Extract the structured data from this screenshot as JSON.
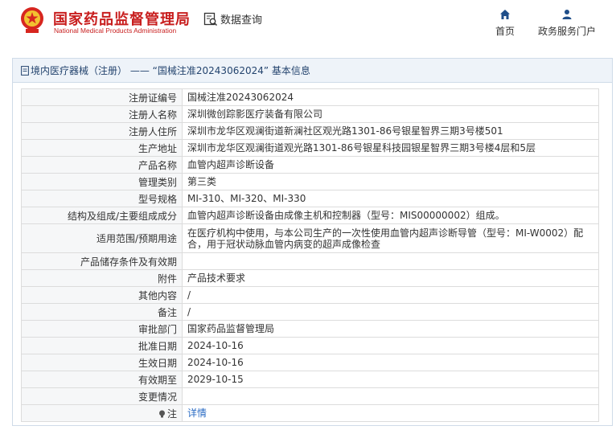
{
  "header": {
    "brand_cn": "国家药品监督管理局",
    "brand_en": "National Medical Products Administration",
    "query_label": "数据查询",
    "nav": [
      {
        "icon": "home-icon",
        "label": "首页"
      },
      {
        "icon": "user-icon",
        "label": "政务服务门户"
      }
    ]
  },
  "panel": {
    "title_type": "境内医疗器械（注册）",
    "title_sep": "——",
    "title_number": "“国械注准20243062024”",
    "title_suffix": "基本信息"
  },
  "rows": [
    {
      "label": "注册证编号",
      "value": "国械注准20243062024"
    },
    {
      "label": "注册人名称",
      "value": "深圳微创踪影医疗装备有限公司"
    },
    {
      "label": "注册人住所",
      "value": "深圳市龙华区观澜街道新澜社区观光路1301-86号银星智界三期3号楼501"
    },
    {
      "label": "生产地址",
      "value": "深圳市龙华区观澜街道观光路1301-86号银星科技园银星智界三期3号楼4层和5层"
    },
    {
      "label": "产品名称",
      "value": "血管内超声诊断设备"
    },
    {
      "label": "管理类别",
      "value": "第三类"
    },
    {
      "label": "型号规格",
      "value": "MI-310、MI-320、MI-330"
    },
    {
      "label": "结构及组成/主要组成成分",
      "value": "血管内超声诊断设备由成像主机和控制器（型号：MIS00000002）组成。"
    },
    {
      "label": "适用范围/预期用途",
      "value": "在医疗机构中使用，与本公司生产的一次性使用血管内超声诊断导管（型号：MI-W0002）配合，用于冠状动脉血管内病变的超声成像检查"
    },
    {
      "label": "产品储存条件及有效期",
      "value": ""
    },
    {
      "label": "附件",
      "value": "产品技术要求"
    },
    {
      "label": "其他内容",
      "value": "/"
    },
    {
      "label": "备注",
      "value": "/"
    },
    {
      "label": "审批部门",
      "value": "国家药品监督管理局"
    },
    {
      "label": "批准日期",
      "value": "2024-10-16"
    },
    {
      "label": "生效日期",
      "value": "2024-10-16"
    },
    {
      "label": "有效期至",
      "value": "2029-10-15"
    },
    {
      "label": "变更情况",
      "value": ""
    }
  ],
  "note_row": {
    "label": "注",
    "link": "详情"
  },
  "colors": {
    "brand_red": "#c81e1e",
    "link_blue": "#2b6cc4",
    "title_bar": "#eef3f9"
  }
}
